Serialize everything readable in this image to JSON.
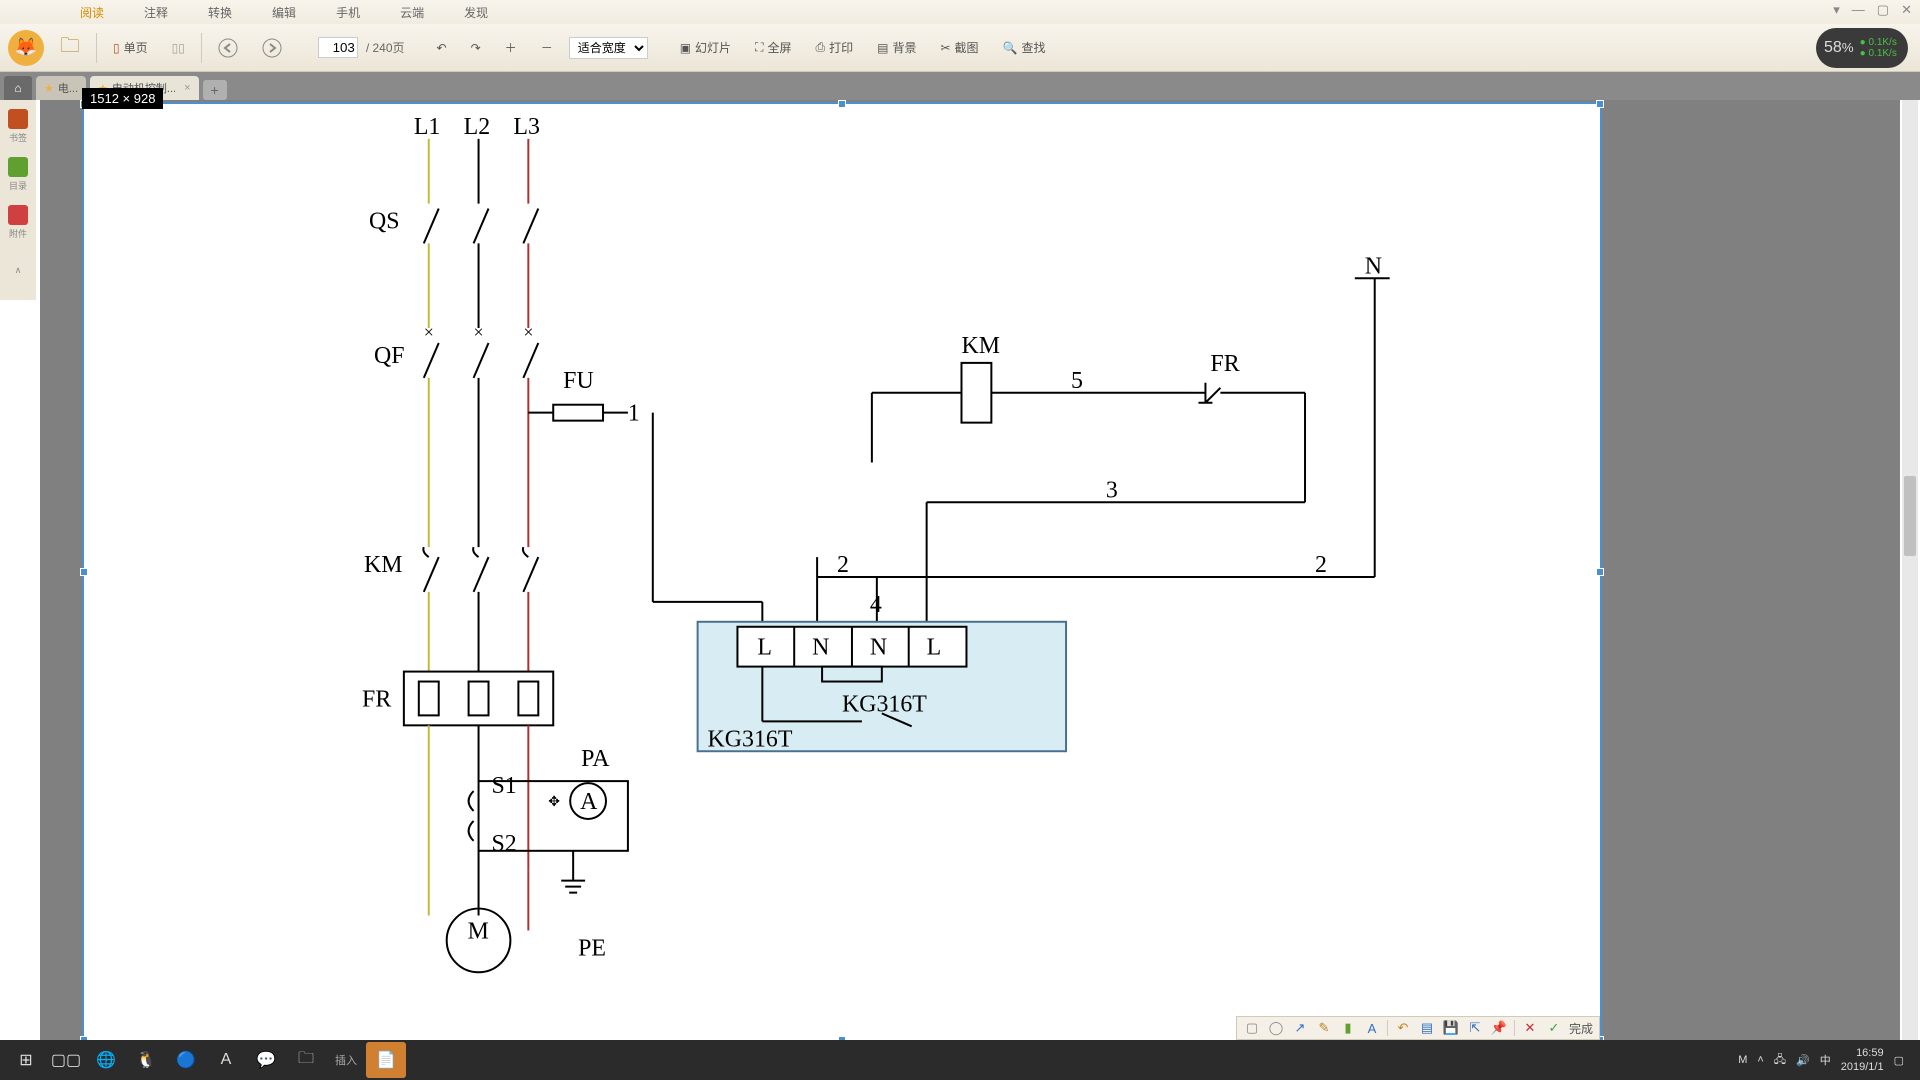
{
  "menu": {
    "items": [
      "阅读",
      "注释",
      "转换",
      "编辑",
      "手机",
      "云端",
      "发现"
    ],
    "active_index": 0
  },
  "win_controls": [
    "▾",
    "—",
    "▢",
    "✕"
  ],
  "toolbar": {
    "single_page": "单页",
    "page_current": "103",
    "page_total": "/ 240页",
    "zoom_mode": "适合宽度",
    "slideshow": "幻灯片",
    "fullscreen": "全屏",
    "print": "打印",
    "background": "背景",
    "screenshot": "截图",
    "find": "查找"
  },
  "speed": {
    "pct": "58",
    "unit": "%",
    "up": "0.1K/s",
    "down": "0.1K/s"
  },
  "tabs": {
    "tab1": "电...",
    "tab2": "电动机控制...",
    "dim_overlay": "1512 × 928"
  },
  "sidebar": {
    "b1": "书签",
    "b2": "目录",
    "b3": "附件"
  },
  "circuit": {
    "L1": "L1",
    "L2": "L2",
    "L3": "L3",
    "QS": "QS",
    "QF": "QF",
    "FU": "FU",
    "wire1": "1",
    "KM": "KM",
    "FR": "FR",
    "S1": "S1",
    "S2": "S2",
    "PA": "PA",
    "A": "A",
    "M": "M",
    "PE": "PE",
    "N": "N",
    "KM2": "KM",
    "FR2": "FR",
    "w5": "5",
    "w3": "3",
    "w2a": "2",
    "w2b": "2",
    "w4": "4",
    "termL1": "L",
    "termN1": "N",
    "termN2": "N",
    "termL2": "L",
    "KG1": "KG316T",
    "KG2": "KG316T"
  },
  "bottom": {
    "done": "完成"
  },
  "tray": {
    "ime": "中",
    "time": "16:59",
    "date": "2019/1/1",
    "m": "M"
  }
}
